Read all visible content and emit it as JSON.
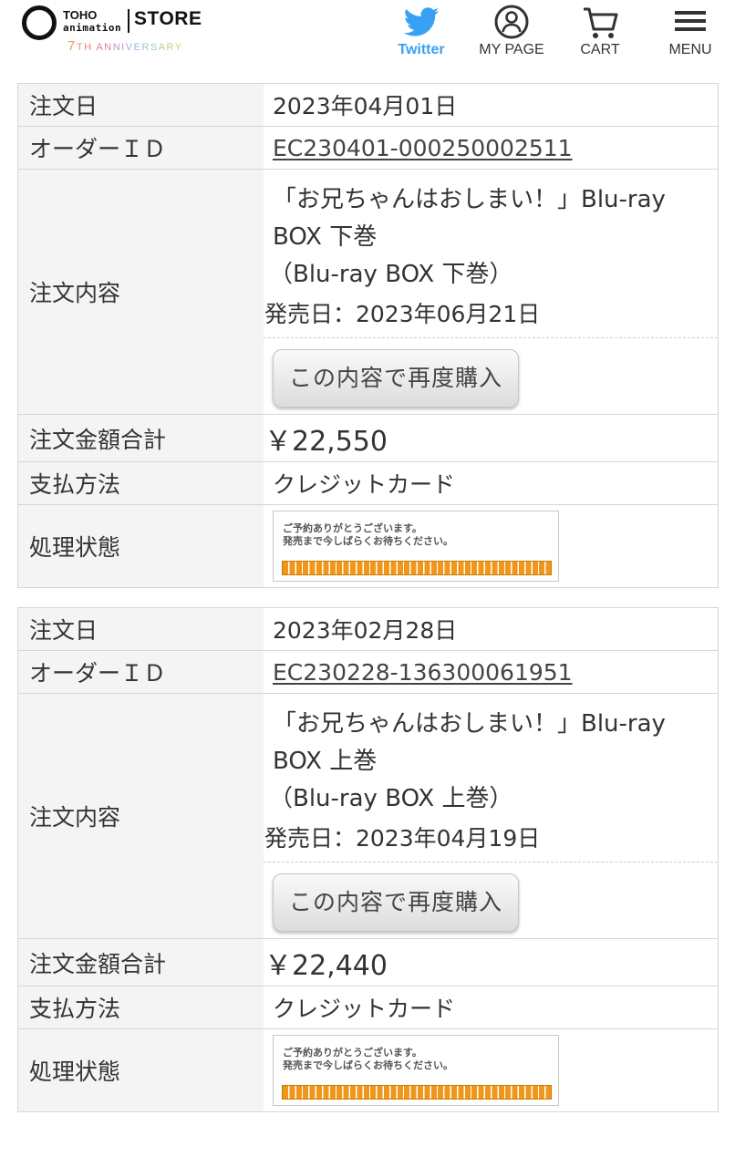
{
  "header": {
    "logo": {
      "brand": "TOHO",
      "sub": "animation",
      "store": "STORE",
      "anniversary_num": "7",
      "anniversary_text": "TH ANNIVERSARY"
    },
    "nav": [
      {
        "label": "Twitter",
        "icon": "twitter-bird-icon"
      },
      {
        "label": "MY PAGE",
        "icon": "user-icon"
      },
      {
        "label": "CART",
        "icon": "cart-icon"
      },
      {
        "label": "MENU",
        "icon": "hamburger-icon"
      }
    ]
  },
  "labels": {
    "order_date": "注文日",
    "order_id": "オーダーＩＤ",
    "order_content": "注文内容",
    "order_total": "注文金額合計",
    "payment_method": "支払方法",
    "status": "処理状態"
  },
  "orders": [
    {
      "date": "2023年04月01日",
      "order_id": "EC230401-000250002511",
      "item_title": "「お兄ちゃんはおしまい！」Blu-ray BOX 下巻",
      "item_sub": "（Blu-ray BOX 下巻）",
      "release": "発売日：2023年06月21日",
      "rebuy_label": "この内容で再度購入",
      "total": "￥22,550",
      "payment": "クレジットカード",
      "status_line1": "ご予約ありがとうございます。",
      "status_line2": "発売まで今しばらくお待ちください。"
    },
    {
      "date": "2023年02月28日",
      "order_id": "EC230228-136300061951",
      "item_title": "「お兄ちゃんはおしまい！」Blu-ray BOX 上巻",
      "item_sub": "（Blu-ray BOX 上巻）",
      "release": "発売日：2023年04月19日",
      "rebuy_label": "この内容で再度購入",
      "total": "￥22,440",
      "payment": "クレジットカード",
      "status_line1": "ご予約ありがとうございます。",
      "status_line2": "発売まで今しばらくお待ちください。"
    }
  ],
  "colors": {
    "twitter": "#38a1f3",
    "status_bar": "#f0961a",
    "label_bg": "#f4f4f4",
    "border": "#d6d6d6"
  }
}
